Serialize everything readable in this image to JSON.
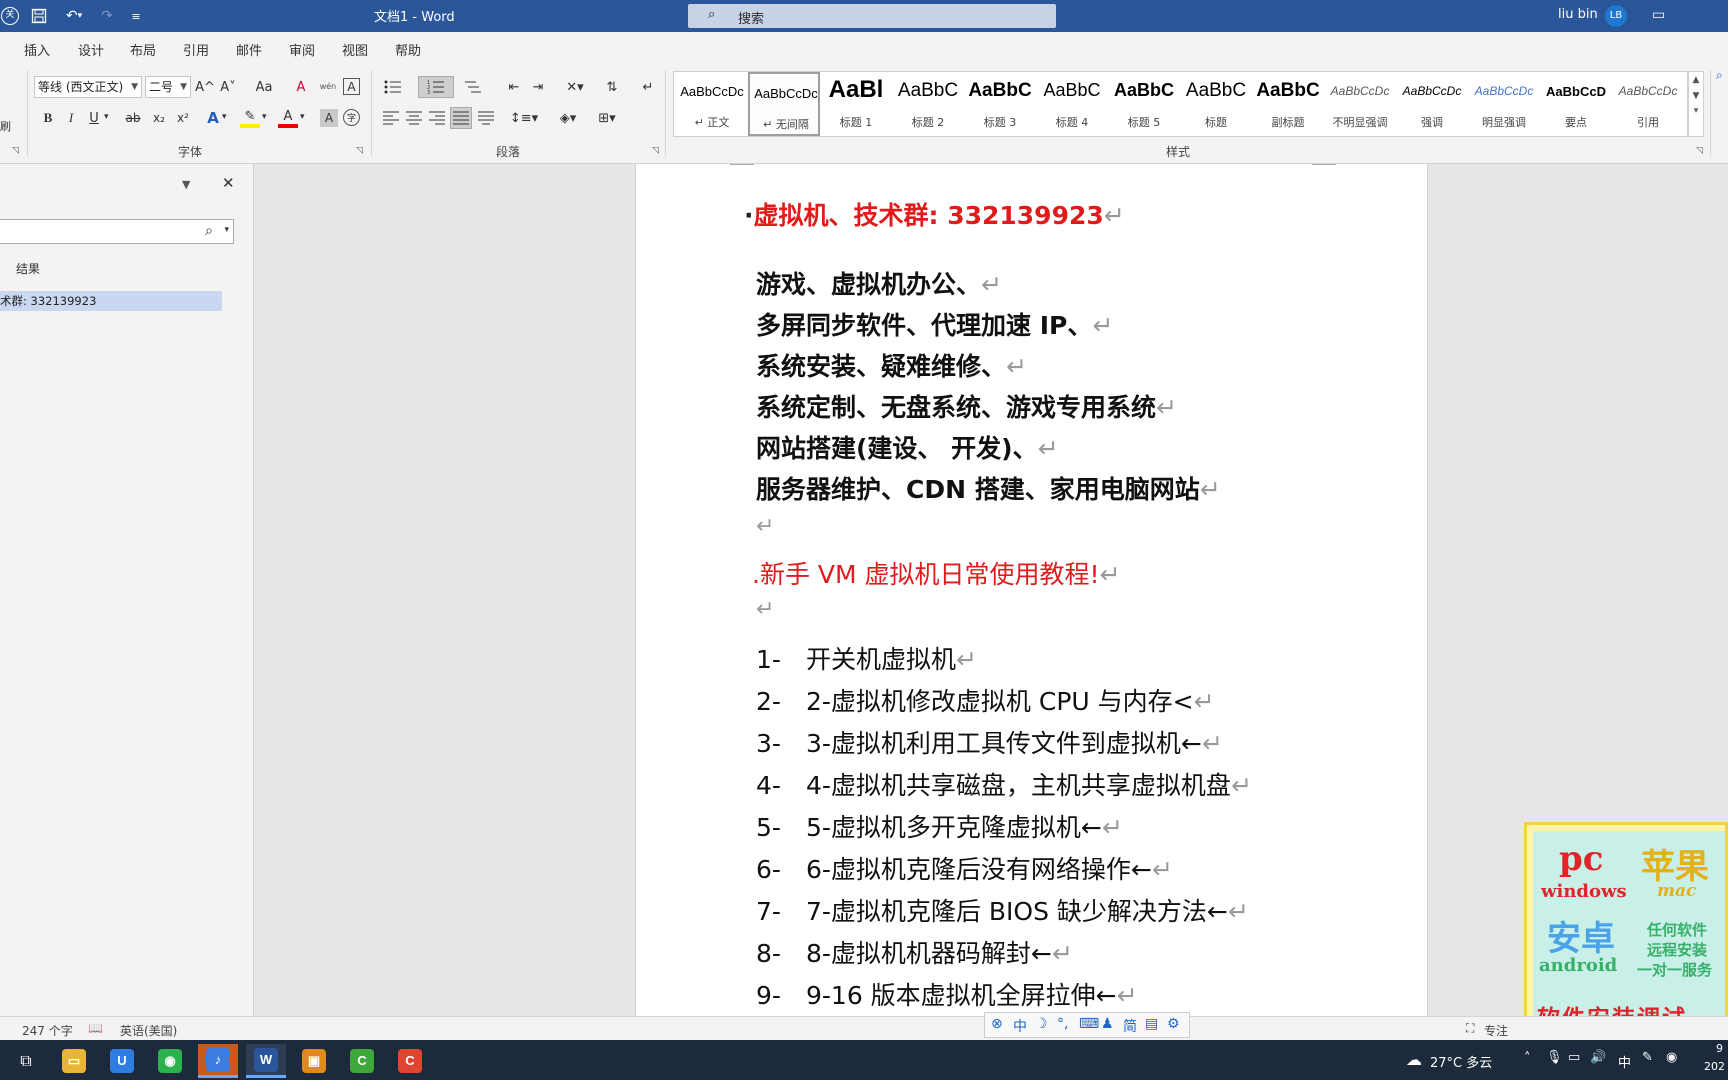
{
  "titlebar": {
    "doc_title": "文档1  -  Word",
    "search_label": "搜索",
    "user_name": "liu bin",
    "avatar_initials": "LB",
    "autosave_label": "关"
  },
  "menu": {
    "tabs": [
      "插入",
      "设计",
      "布局",
      "引用",
      "邮件",
      "审阅",
      "视图",
      "帮助"
    ]
  },
  "ribbon": {
    "clipboard_label": "刷",
    "font_group_label": "字体",
    "paragraph_group_label": "段落",
    "styles_group_label": "样式",
    "font_name": "等线 (西文正文)",
    "font_size": "二号",
    "grow_font": "A^",
    "shrink_font": "A˅",
    "change_case": "Aa",
    "clear_format": "A",
    "phonetic_guide": "wén",
    "char_border": "A",
    "bold": "B",
    "italic": "I",
    "underline": "U",
    "strikethrough": "ab",
    "subscript": "x₂",
    "superscript": "x²",
    "text_effect": "A",
    "highlight": "✎",
    "font_color": "A",
    "char_shading": "A",
    "enclosed_char": "字",
    "styles": [
      {
        "sample": "AaBbCcDc",
        "name": "↵ 正文"
      },
      {
        "sample": "AaBbCcDc",
        "name": "↵ 无间隔"
      },
      {
        "sample": "AaBl",
        "name": "标题 1"
      },
      {
        "sample": "AaBbC",
        "name": "标题 2"
      },
      {
        "sample": "AaBbC",
        "name": "标题 3"
      },
      {
        "sample": "AaBbC",
        "name": "标题 4"
      },
      {
        "sample": "AaBbC",
        "name": "标题 5"
      },
      {
        "sample": "AaBbC",
        "name": "标题"
      },
      {
        "sample": "AaBbC",
        "name": "副标题"
      },
      {
        "sample": "AaBbCcDc",
        "name": "不明显强调"
      },
      {
        "sample": "AaBbCcDc",
        "name": "强调"
      },
      {
        "sample": "AaBbCcDc",
        "name": "明显强调"
      },
      {
        "sample": "AaBbCcD",
        "name": "要点"
      },
      {
        "sample": "AaBbCcDc",
        "name": "引用"
      }
    ]
  },
  "nav_pane": {
    "results_tab": "结果",
    "search_icon": "⌕",
    "result_item": "术群: 332139923",
    "close": "✕"
  },
  "document": {
    "heading": "虚拟机、技术群: 332139923",
    "bold_lines": [
      "游戏、虚拟机办公、",
      "多屏同步软件、代理加速 IP、",
      "系统安装、疑难维修、",
      "系统定制、无盘系统、游戏专用系统",
      "网站搭建(建设、 开发)、",
      "服务器维护、CDN 搭建、家用电脑网站"
    ],
    "red_line": ".新手 VM 虚拟机日常使用教程!",
    "list": [
      {
        "num": "1-",
        "text": "开关机虚拟机"
      },
      {
        "num": "2-",
        "text": "2-虚拟机修改虚拟机 CPU 与内存<"
      },
      {
        "num": "3-",
        "text": "3-虚拟机利用工具传文件到虚拟机←"
      },
      {
        "num": "4-",
        "text": "4-虚拟机共享磁盘，主机共享虚拟机盘"
      },
      {
        "num": "5-",
        "text": "5-虚拟机多开克隆虚拟机←"
      },
      {
        "num": "6-",
        "text": "6-虚拟机克隆后没有网络操作←"
      },
      {
        "num": "7-",
        "text": "7-虚拟机克隆后 BIOS 缺少解决方法←"
      },
      {
        "num": "8-",
        "text": "8-虚拟机机器码解封←"
      },
      {
        "num": "9-",
        "text": "9-16 版本虚拟机全屏拉伸←"
      }
    ],
    "para_mark": "↵"
  },
  "ad": {
    "pc": "pc",
    "windows": "windows",
    "apple": "苹果",
    "mac": "mac",
    "anzhuo": "安卓",
    "android": "android",
    "any_software": "任何软件",
    "remote": "远程安装",
    "one_on_one": "一对一服务",
    "install_debug": "软件安装调试"
  },
  "statusbar": {
    "word_count": "247 个字",
    "language": "英语(美国)",
    "focus": "专注"
  },
  "ime": {
    "chars": [
      "中",
      "简"
    ]
  },
  "tray": {
    "weather": "27°C  多云",
    "ime_lang": "中",
    "clock_partial_top": "9",
    "clock_partial_bottom": "202"
  },
  "colors": {
    "titlebar": "#2b579a",
    "heading_red": "#e01b1b",
    "nav_highlight": "#c9d7f0",
    "taskbar": "#1c2a3c"
  }
}
